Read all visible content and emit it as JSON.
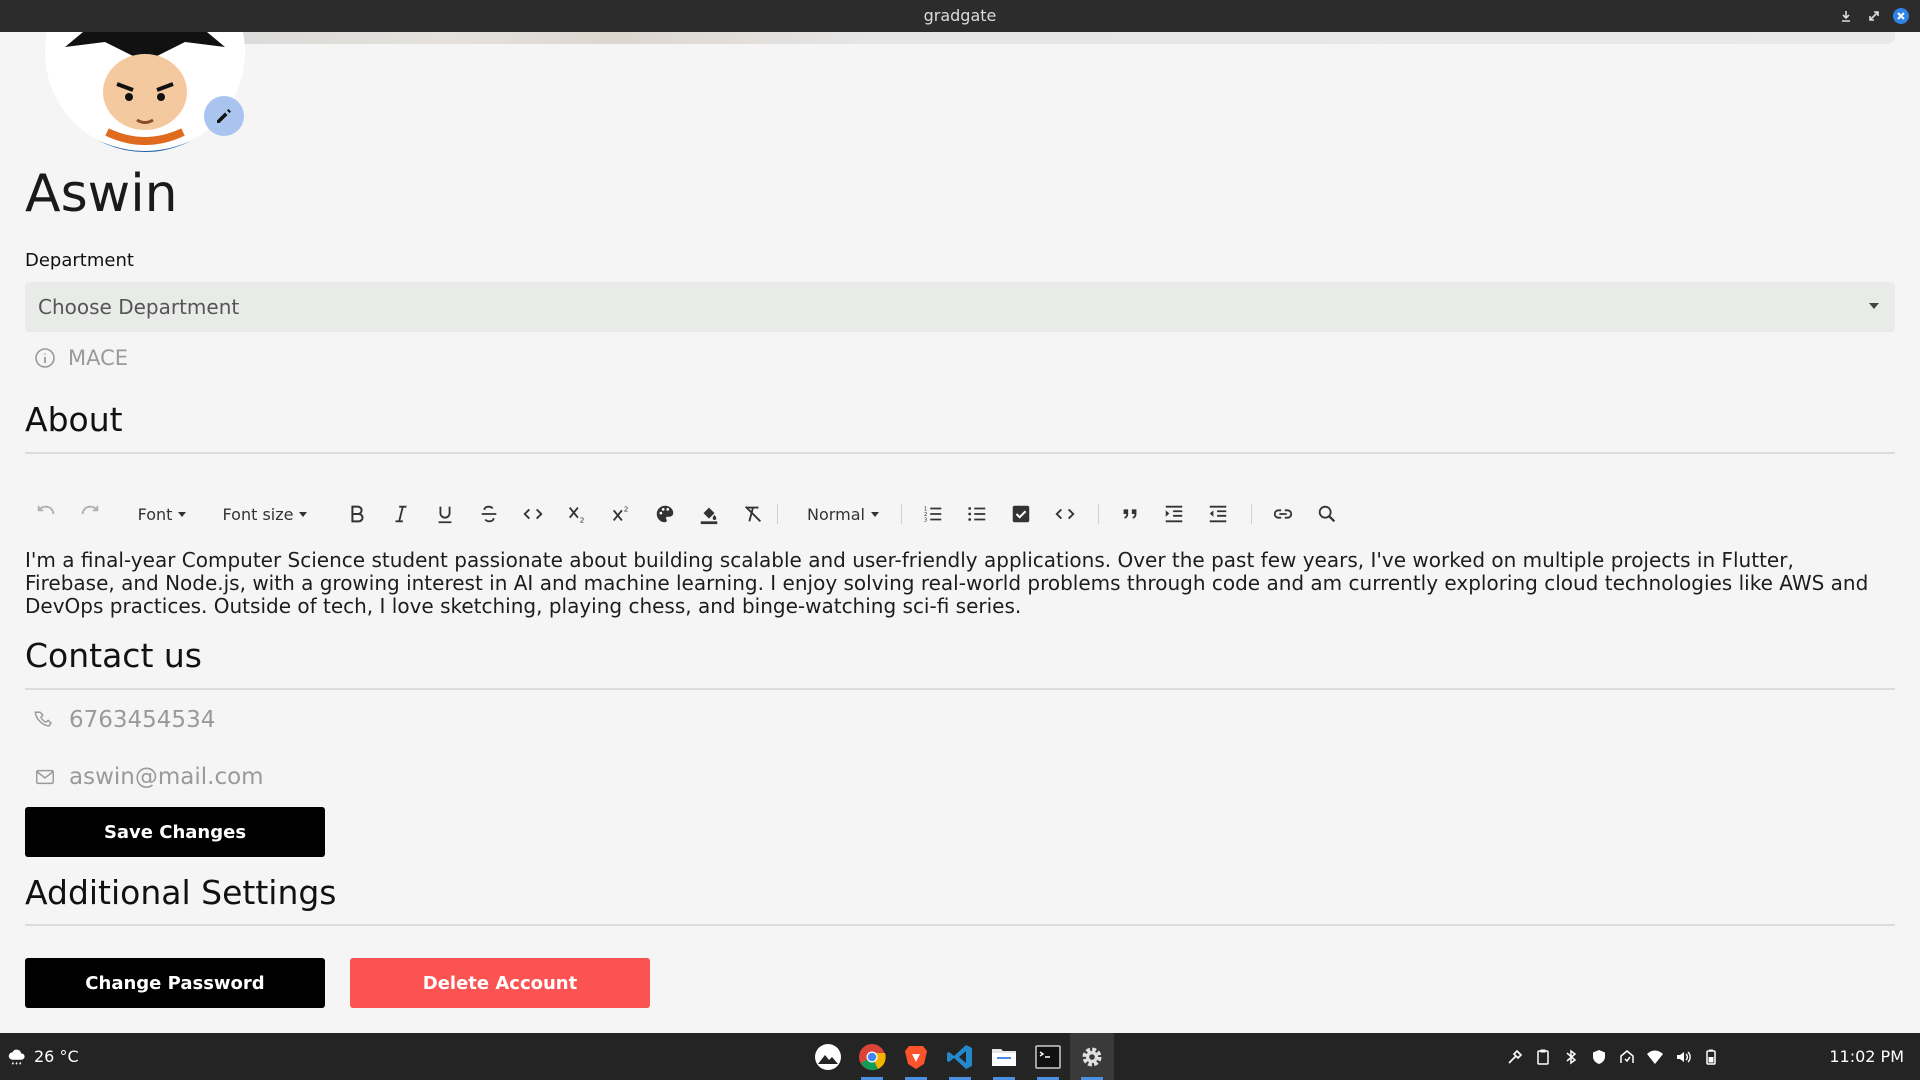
{
  "window": {
    "title": "gradgate"
  },
  "profile": {
    "name": "Aswin",
    "department_label": "Department",
    "department_placeholder": "Choose Department",
    "department_helper": "MACE"
  },
  "about": {
    "title": "About",
    "text": "I'm a final-year Computer Science student passionate about building scalable and user-friendly applications. Over the past few years, I've worked on multiple projects in Flutter, Firebase, and Node.js, with a growing interest in AI and machine learning. I enjoy solving real-world problems through code and am currently exploring cloud technologies like AWS and DevOps practices. Outside of tech, I love sketching, playing chess, and binge-watching sci-fi series."
  },
  "editor_toolbar": {
    "font_label": "Font",
    "font_size_label": "Font size",
    "block_label": "Normal",
    "icons": [
      "undo-icon",
      "redo-icon",
      "bold-icon",
      "italic-icon",
      "underline-icon",
      "strikethrough-icon",
      "code-icon",
      "subscript-icon",
      "superscript-icon",
      "palette-icon",
      "fill-color-icon",
      "clear-format-icon",
      "ordered-list-icon",
      "bullet-list-icon",
      "check-list-icon",
      "code-block-icon",
      "quote-icon",
      "indent-icon",
      "outdent-icon",
      "link-icon",
      "search-icon"
    ]
  },
  "contact": {
    "title": "Contact us",
    "phone": "6763454534",
    "email": "aswin@mail.com"
  },
  "buttons": {
    "save": "Save Changes",
    "change_password": "Change Password",
    "delete_account": "Delete Account"
  },
  "additional": {
    "title": "Additional Settings"
  },
  "taskbar": {
    "weather": "26 °C",
    "time": "11:02 PM",
    "apps": [
      "launcher-icon",
      "chrome-icon",
      "brave-icon",
      "vscode-icon",
      "files-icon",
      "terminal-icon",
      "settings-icon"
    ]
  },
  "colors": {
    "accent_red": "#fb5252",
    "edit_badge": "#a9c4ee",
    "taskbar_indicator": "#4b8fe0"
  }
}
